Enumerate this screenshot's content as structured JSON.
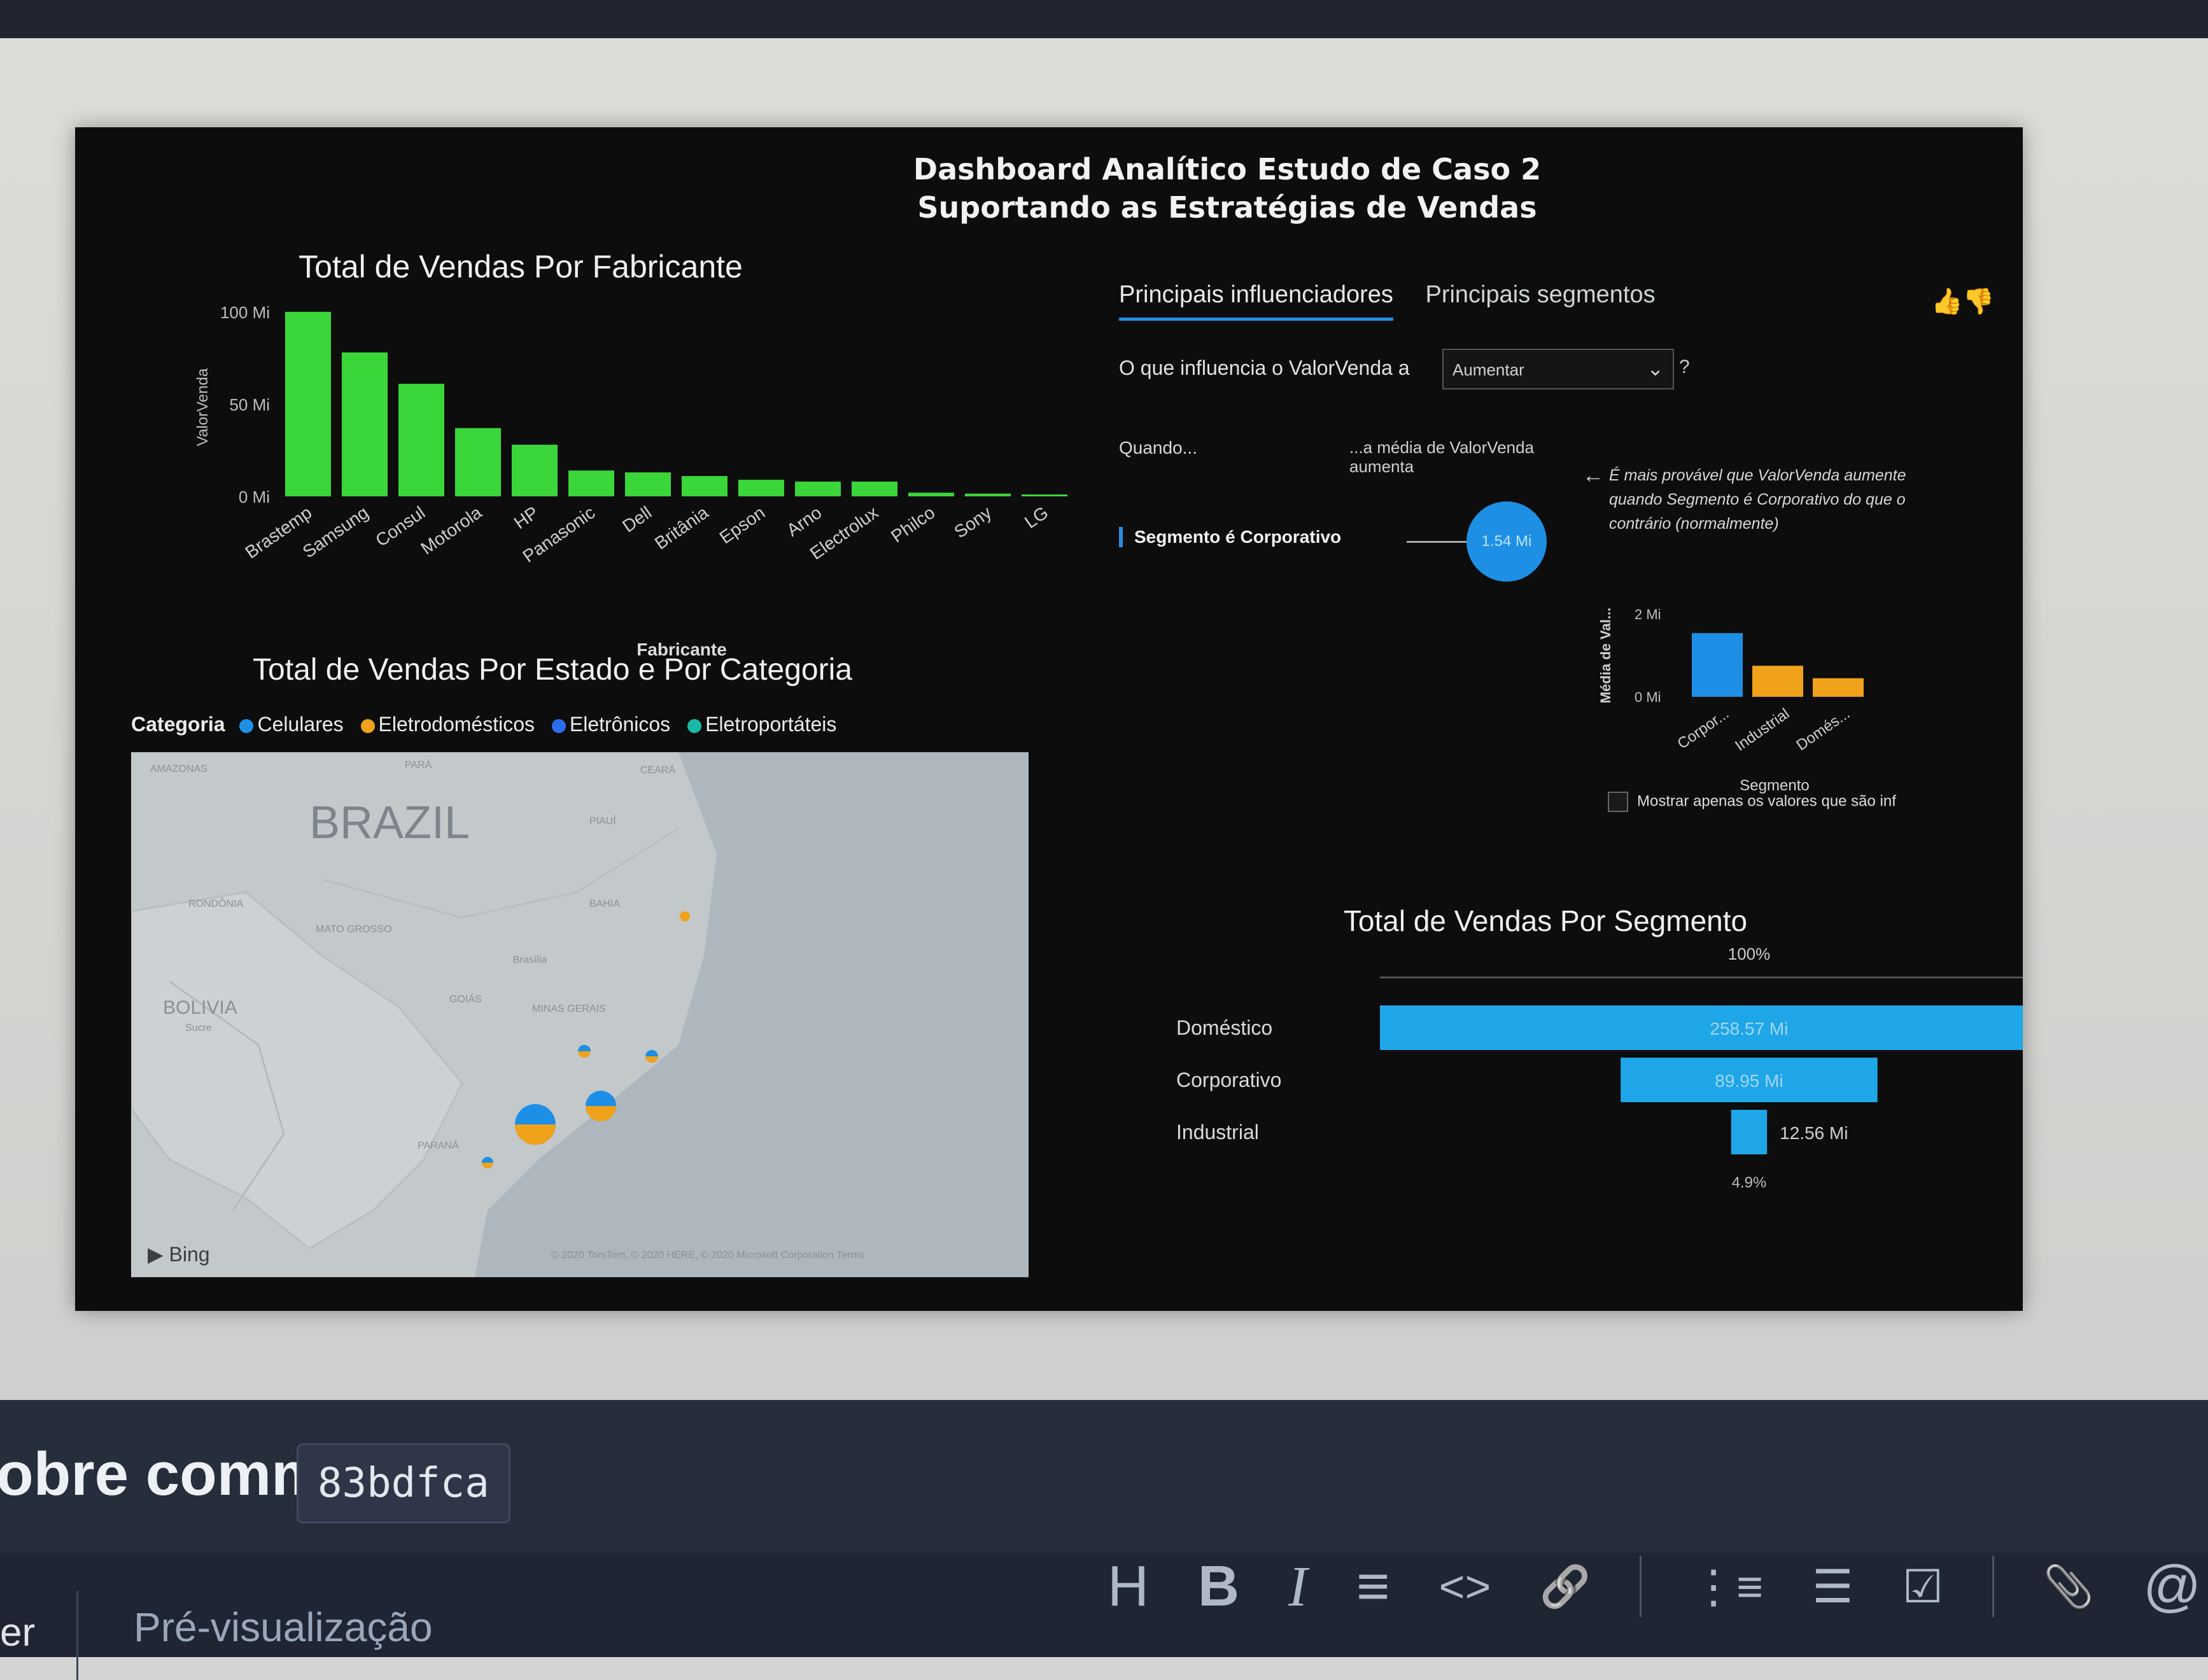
{
  "dashboard": {
    "title_line1": "Dashboard Analítico Estudo de Caso 2",
    "title_line2": "Suportando as Estratégias de Vendas"
  },
  "manufacturer_chart": {
    "title": "Total de Vendas Por Fabricante",
    "xlabel": "Fabricante",
    "ylabel": "ValorVenda",
    "tick_labels": [
      "0 Mi",
      "50 Mi",
      "100 Mi"
    ]
  },
  "state_chart": {
    "title": "Total de Vendas Por Estado e Por Categoria",
    "legend_title": "Categoria",
    "legend": [
      "Celulares",
      "Eletrodomésticos",
      "Eletrônicos",
      "Eletroportáteis"
    ],
    "map_title": "BRAZIL",
    "map_labels": [
      "BOLIVIA",
      "AMAZONAS",
      "PARÁ",
      "MATO GROSSO",
      "RONDÔNIA",
      "Brasília",
      "GOIÁS",
      "MINAS GERAIS",
      "BAHIA",
      "PARANÁ",
      "PIAUÍ",
      "CEARÁ",
      "Sucre"
    ],
    "bing": "Bing",
    "copyright": "© 2020 TomTom, © 2020 HERE, © 2020 Microsoft Corporation  Terms"
  },
  "influencers": {
    "tab_active": "Principais influenciadores",
    "tab_other": "Principais segmentos",
    "question": "O que influencia o ValorVenda a",
    "select_value": "Aumentar",
    "help": "?",
    "when": "Quando...",
    "average": "...a média de ValorVenda aumenta",
    "segment_row": "Segmento é Corporativo",
    "bubble_value": "1.54 Mi",
    "note": "É mais provável que ValorVenda aumente quando Segmento é Corporativo do que o contrário (normalmente)",
    "mini_ylabel": "Média de Val...",
    "mini_xlabel": "Segmento",
    "mini_ticks": [
      "0 Mi",
      "2 Mi"
    ],
    "mini_categories": [
      "Corpor...",
      "Industrial",
      "Domés..."
    ],
    "checkbox_label": "Mostrar apenas os valores que são inf"
  },
  "segment_chart": {
    "title": "Total de Vendas Por Segmento",
    "pct_top": "100%",
    "pct_bottom": "4.9%"
  },
  "github": {
    "commit_label": "obre commit",
    "commit_hash": "83bdfca",
    "tab_left": "er",
    "preview_tab": "Pré-visualização"
  },
  "toolbar": {
    "items": [
      "H",
      "B",
      "I",
      "≡",
      "<>",
      "🔗",
      "⋮≡",
      "☰",
      "☑",
      "📎",
      "@"
    ]
  },
  "chart_data": [
    {
      "type": "bar",
      "title": "Total de Vendas Por Fabricante",
      "xlabel": "Fabricante",
      "ylabel": "ValorVenda",
      "categories": [
        "Brastemp",
        "Samsung",
        "Consul",
        "Motorola",
        "HP",
        "Panasonic",
        "Dell",
        "Britânia",
        "Epson",
        "Arno",
        "Electrolux",
        "Philco",
        "Sony",
        "LG"
      ],
      "values": [
        100,
        78,
        61,
        37,
        28,
        14,
        13,
        11,
        9,
        8,
        8,
        2,
        1.5,
        1
      ],
      "unit": "Mi",
      "ylim": [
        0,
        100
      ],
      "color": "#3ad63a"
    },
    {
      "type": "bar",
      "title": "Total de Vendas Por Segmento",
      "categories": [
        "Doméstico",
        "Corporativo",
        "Industrial"
      ],
      "values": [
        258.57,
        89.95,
        12.56
      ],
      "labels": [
        "258.57 Mi",
        "89.95 Mi",
        "12.56 Mi"
      ],
      "unit": "Mi",
      "color": "#1fa6e8"
    },
    {
      "type": "bar",
      "xlabel": "Segmento",
      "ylabel": "Média de Val...",
      "categories": [
        "Corpor...",
        "Industrial",
        "Domés..."
      ],
      "values": [
        1.54,
        0.75,
        0.45
      ],
      "unit": "Mi",
      "ylim": [
        0,
        2
      ],
      "colors": [
        "#1d8fe6",
        "#f0a21a",
        "#f0a21a"
      ]
    }
  ]
}
